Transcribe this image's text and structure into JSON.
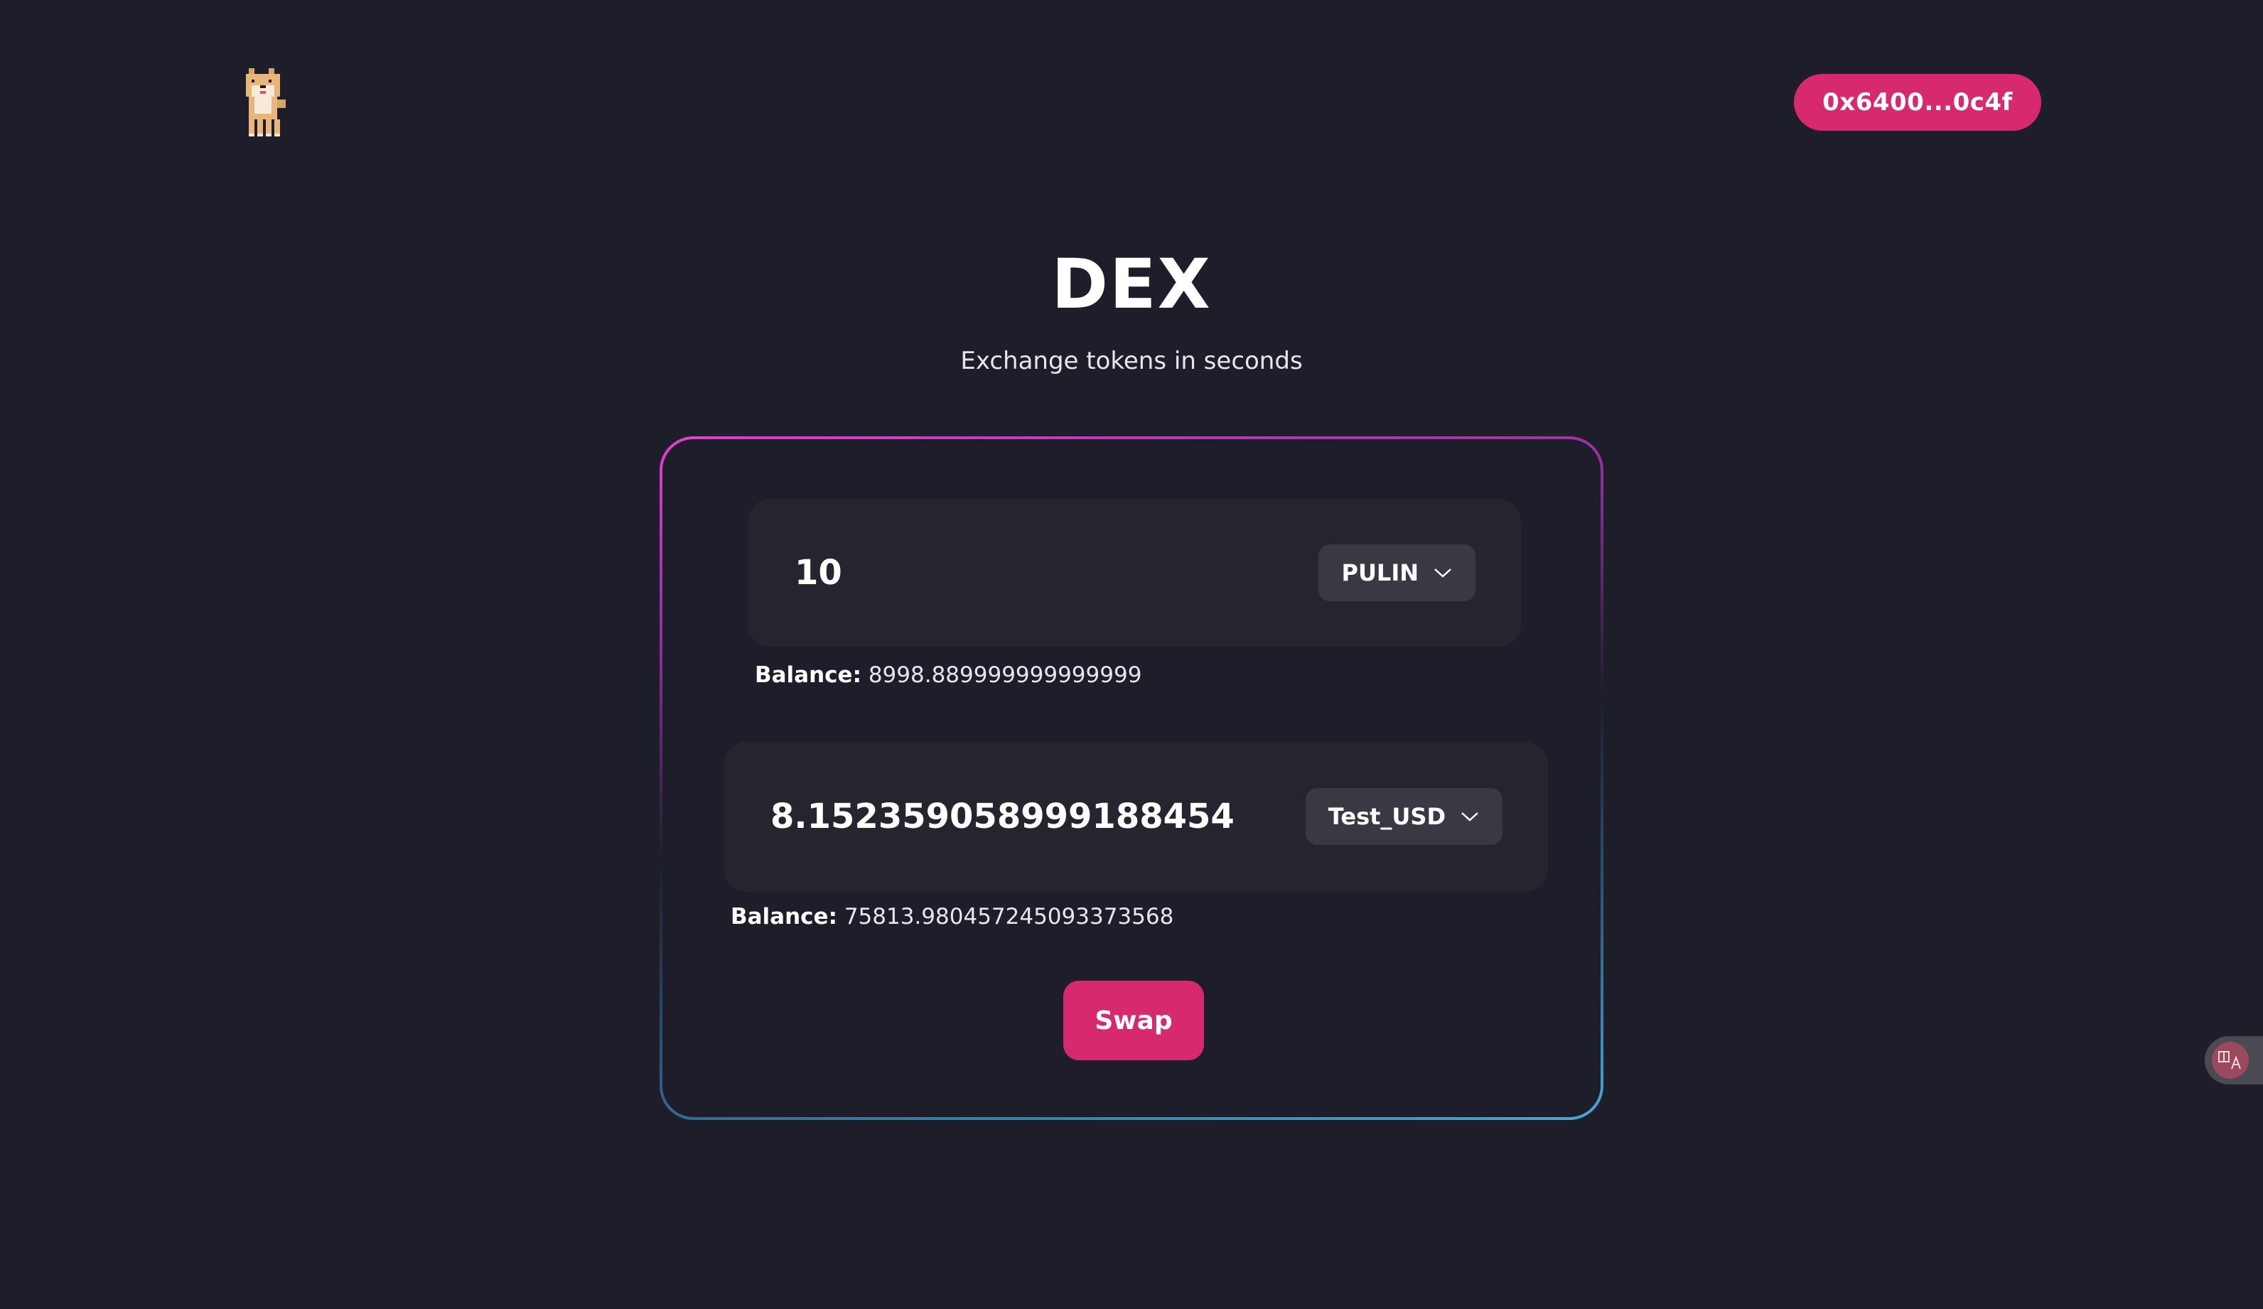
{
  "header": {
    "logo_icon": "shiba-dog-icon",
    "wallet_address": "0x6400...0c4f"
  },
  "hero": {
    "title": "DEX",
    "subtitle": "Exchange tokens in seconds"
  },
  "swap": {
    "from": {
      "amount": "10",
      "token": "PULIN",
      "balance_label": "Balance:",
      "balance_value": "8998.889999999999999"
    },
    "to": {
      "amount": "8.152359058999188454",
      "token": "Test_USD",
      "balance_label": "Balance:",
      "balance_value": "75813.980457245093373568"
    },
    "button_label": "Swap"
  },
  "translate_widget": {
    "icon": "translate-icon"
  },
  "colors": {
    "background": "#1e1e2a",
    "accent": "#d7296d",
    "panel": "#26252f",
    "selector": "#393944"
  }
}
